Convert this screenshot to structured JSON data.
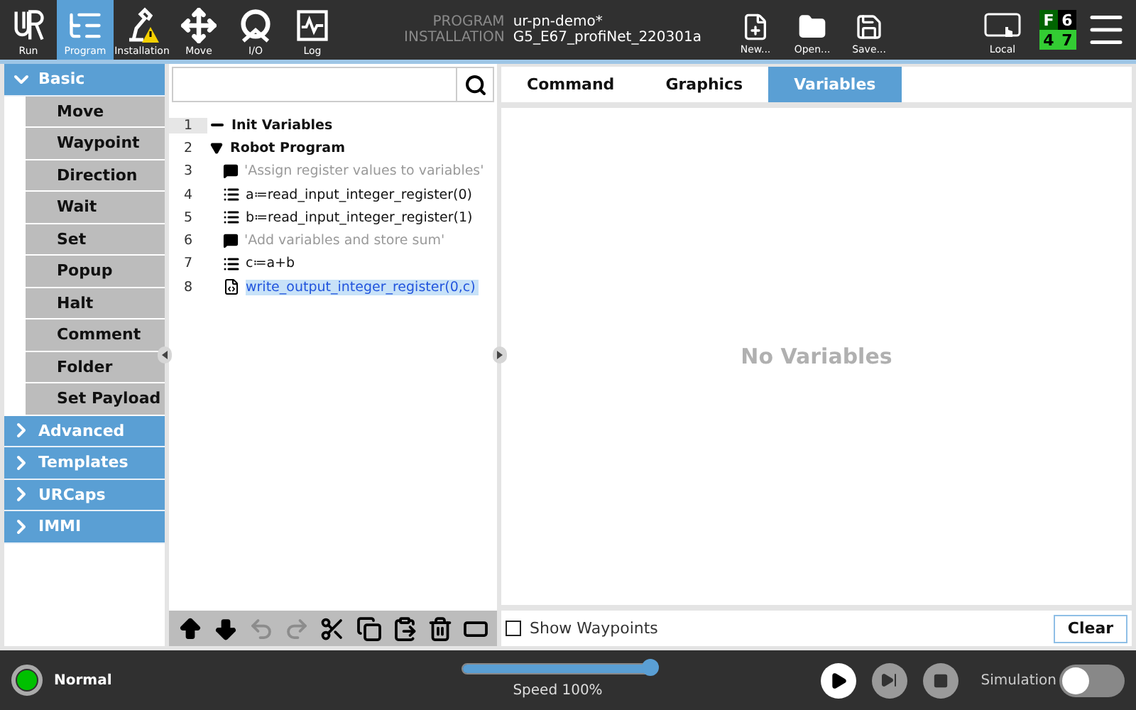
{
  "header": {
    "nav": [
      {
        "label": "Run",
        "selected": false
      },
      {
        "label": "Program",
        "selected": true
      },
      {
        "label": "Installation",
        "selected": false
      },
      {
        "label": "Move",
        "selected": false
      },
      {
        "label": "I/O",
        "selected": false
      },
      {
        "label": "Log",
        "selected": false
      }
    ],
    "program_label": "PROGRAM",
    "program_name": "ur-pn-demo*",
    "installation_label": "INSTALLATION",
    "installation_name": "G5_E67_profiNet_220301a",
    "file_buttons": [
      "New...",
      "Open...",
      "Save..."
    ],
    "mode": "Local",
    "status_cells": [
      {
        "text": "F",
        "color": "#006400"
      },
      {
        "text": "6",
        "color": "#000000"
      },
      {
        "text": "4",
        "color": "#33cc33"
      },
      {
        "text": "7",
        "color": "#33cc33"
      }
    ]
  },
  "sidebar": {
    "groups": [
      {
        "label": "Basic",
        "expanded": true,
        "items": [
          "Move",
          "Waypoint",
          "Direction",
          "Wait",
          "Set",
          "Popup",
          "Halt",
          "Comment",
          "Folder",
          "Set Payload"
        ]
      },
      {
        "label": "Advanced",
        "expanded": false
      },
      {
        "label": "Templates",
        "expanded": false
      },
      {
        "label": "URCaps",
        "expanded": false
      },
      {
        "label": "IMMI",
        "expanded": false
      }
    ]
  },
  "program_tree": {
    "rows": [
      {
        "number": "1",
        "kind": "folder",
        "text": "Init Variables",
        "selected": false
      },
      {
        "number": "2",
        "kind": "program",
        "text": "Robot Program",
        "selected": false,
        "expanded": true,
        "children": [
          {
            "number": "3",
            "kind": "comment",
            "text": "'Assign register values to variables'",
            "selected": false
          },
          {
            "number": "4",
            "kind": "assign",
            "text": "a≔read_input_integer_register(0)",
            "selected": false
          },
          {
            "number": "5",
            "kind": "assign",
            "text": "b≔read_input_integer_register(1)",
            "selected": false
          },
          {
            "number": "6",
            "kind": "comment",
            "text": "'Add variables and store sum'",
            "selected": false
          },
          {
            "number": "7",
            "kind": "assign",
            "text": "c≔a+b",
            "selected": false
          },
          {
            "number": "8",
            "kind": "script",
            "text": "write_output_integer_register(0,c)",
            "selected": true
          }
        ]
      }
    ],
    "toolbar": [
      {
        "disabled": false
      },
      {
        "disabled": false
      },
      {
        "disabled": true
      },
      {
        "disabled": true
      },
      {
        "disabled": false
      },
      {
        "disabled": false
      },
      {
        "disabled": false
      },
      {
        "disabled": false
      },
      {
        "disabled": false
      }
    ]
  },
  "tabs": [
    {
      "label": "Command",
      "selected": false
    },
    {
      "label": "Graphics",
      "selected": false
    },
    {
      "label": "Variables",
      "selected": true
    }
  ],
  "variables": {
    "empty_text": "No Variables",
    "show_waypoints": {
      "label": "Show Waypoints",
      "checked": false
    },
    "clear_button": "Clear"
  },
  "footer": {
    "status": {
      "text": "Normal",
      "color": "#00c000"
    },
    "speed": {
      "level": 1.0,
      "label": "Speed 100%"
    },
    "simulation": {
      "label": "Simulation",
      "on": false
    }
  }
}
